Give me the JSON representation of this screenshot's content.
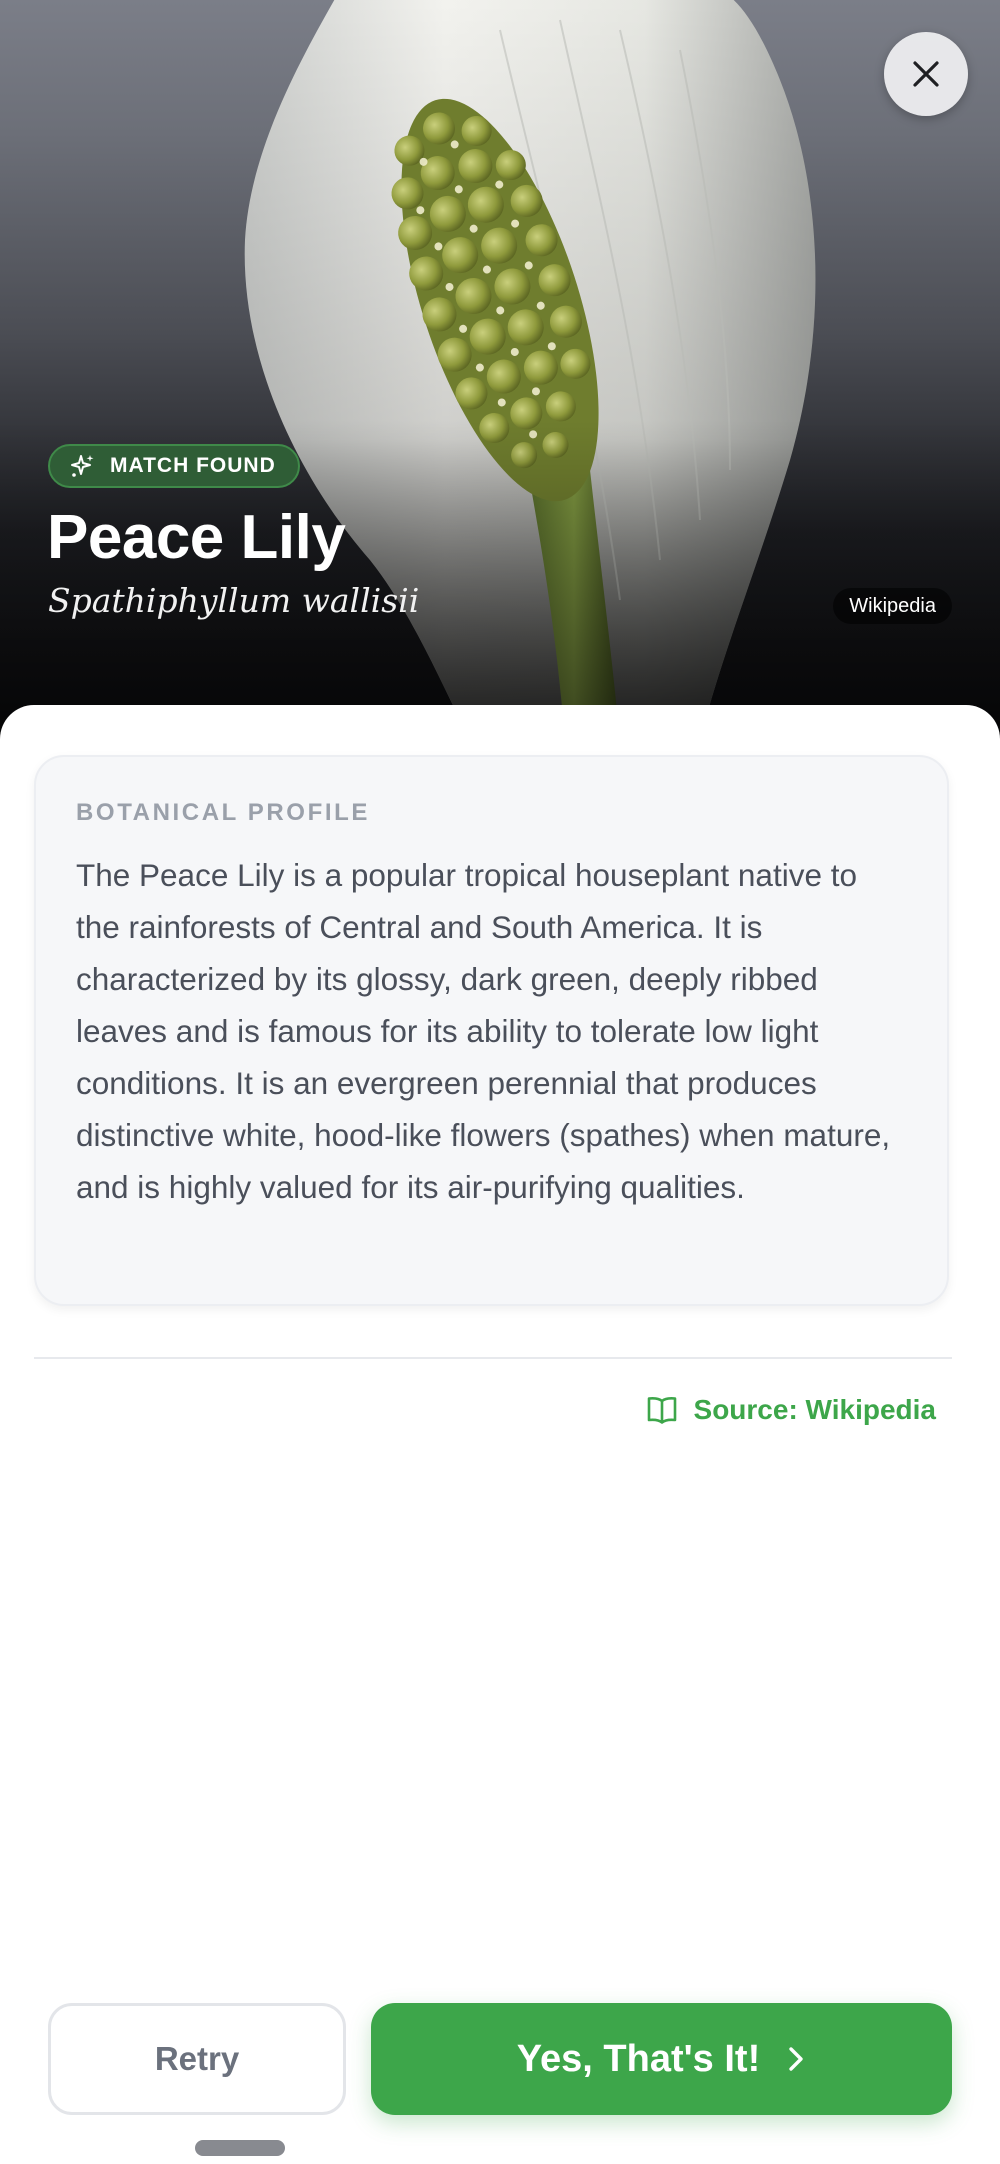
{
  "header": {
    "photo_alt": "peace-lily-flower-photo",
    "badge_label": "MATCH FOUND",
    "plant_name": "Peace Lily",
    "scientific_name": "Spathiphyllum wallisii",
    "image_credit": "Wikipedia"
  },
  "profile": {
    "section_label": "BOTANICAL PROFILE",
    "description": "The Peace Lily is a popular tropical houseplant native to the rainforests of Central and South America. It is characterized by its glossy, dark green, deeply ribbed leaves and is famous for its ability to tolerate low light conditions. It is an evergreen perennial that produces distinctive white, hood-like flowers (spathes) when mature, and is highly valued for its air-purifying qualities."
  },
  "source": {
    "label": "Source: Wikipedia",
    "icon": "open-book-icon"
  },
  "actions": {
    "retry_label": "Retry",
    "confirm_label": "Yes, That's It!",
    "confirm_icon": "chevron-right-icon"
  },
  "colors": {
    "accent_green": "#3da64a",
    "badge_bg": "#2f5d36",
    "card_bg": "#f6f7f9",
    "text_muted": "#9aa0aa"
  }
}
